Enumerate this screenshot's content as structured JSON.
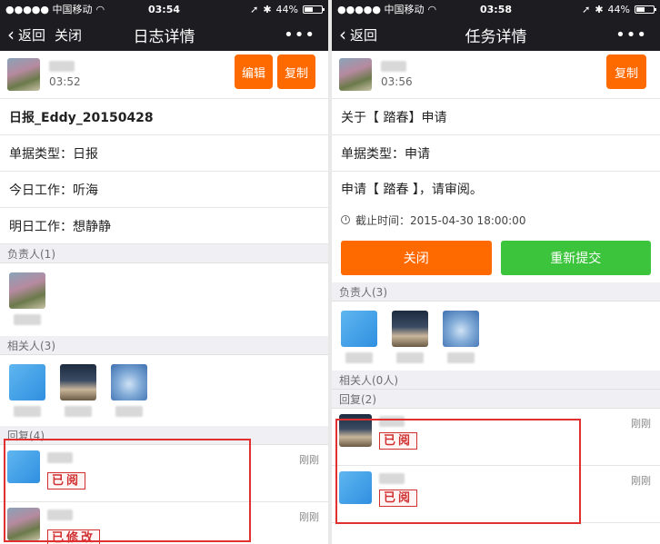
{
  "left": {
    "status": {
      "carrier": "●●●●● 中国移动",
      "time": "03:54",
      "battery": "44%",
      "battery_level": 0.44
    },
    "nav": {
      "back": "返回",
      "close": "关闭",
      "title": "日志详情",
      "more": "•••"
    },
    "header": {
      "time": "03:52",
      "edit": "编辑",
      "copy": "复制"
    },
    "title_row": "日报_Eddy_20150428",
    "type_row": "单据类型：日报",
    "today_row": "今日工作：听海",
    "tomorrow_row": "明日工作：想静静",
    "owners_label": "负责人(1)",
    "related_label": "相关人(3)",
    "replies_label": "回复(4)",
    "replies": [
      {
        "time": "刚刚",
        "stamp": "已阅"
      },
      {
        "time": "刚刚",
        "stamp": "已修改"
      }
    ]
  },
  "right": {
    "status": {
      "carrier": "●●●●● 中国移动",
      "time": "03:58",
      "battery": "44%",
      "battery_level": 0.44
    },
    "nav": {
      "back": "返回",
      "title": "任务详情",
      "more": "•••"
    },
    "header": {
      "time": "03:56",
      "copy": "复制"
    },
    "title_row": "关于【 踏春】申请",
    "type_row": "单据类型：申请",
    "content_row": "申请【 踏春 】，请审阅。",
    "deadline": "截止时间：2015-04-30 18:00:00",
    "close_button": "关闭",
    "resubmit_button": "重新提交",
    "owners_label": "负责人(3)",
    "related_label": "相关人(0人)",
    "replies_label": "回复(2)",
    "replies": [
      {
        "time": "刚刚",
        "stamp": "已阅"
      },
      {
        "time": "刚刚",
        "stamp": "已阅"
      }
    ]
  },
  "colors": {
    "orange": "#ff6a00",
    "green": "#3cc43c",
    "stamp_red": "#d03030",
    "nav_bg": "#1d1d21"
  }
}
